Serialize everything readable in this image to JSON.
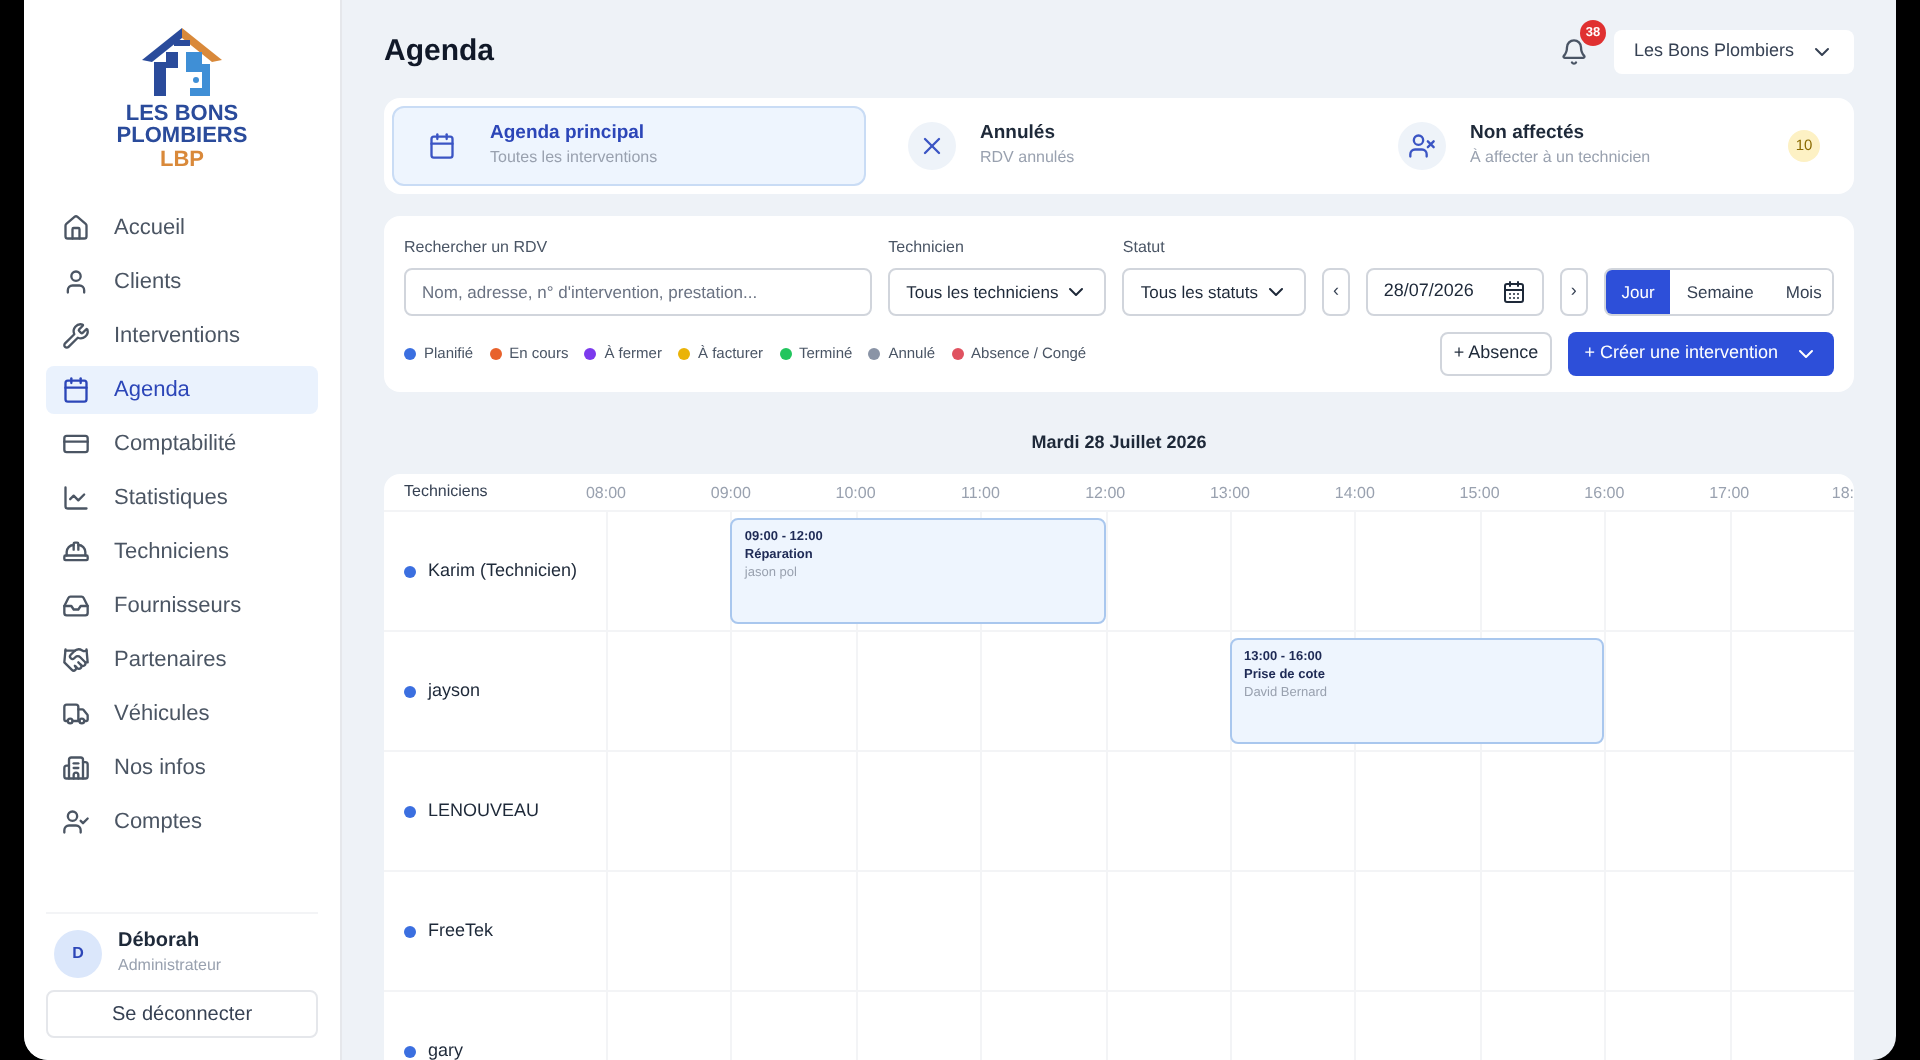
{
  "brand": {
    "line_1": "LES BONS",
    "line_2": "PLOMBIERS",
    "line_3": "LBP"
  },
  "sidebar": {
    "items": [
      {
        "label": "Accueil",
        "selected": false
      },
      {
        "label": "Clients",
        "selected": false
      },
      {
        "label": "Interventions",
        "selected": false
      },
      {
        "label": "Agenda",
        "selected": true
      },
      {
        "label": "Comptabilité",
        "selected": false
      },
      {
        "label": "Statistiques",
        "selected": false
      },
      {
        "label": "Techniciens",
        "selected": false
      },
      {
        "label": "Fournisseurs",
        "selected": false
      },
      {
        "label": "Partenaires",
        "selected": false
      },
      {
        "label": "Véhicules",
        "selected": false
      },
      {
        "label": "Nos infos",
        "selected": false
      },
      {
        "label": "Comptes",
        "selected": false
      }
    ],
    "user": {
      "initial": "D",
      "name": "Déborah",
      "role": "Administrateur"
    },
    "logout": "Se déconnecter"
  },
  "header": {
    "title": "Agenda",
    "notifications": "38",
    "company": "Les Bons Plombiers"
  },
  "tabs": [
    {
      "title": "Agenda principal",
      "subtitle": "Toutes les interventions",
      "selected": true
    },
    {
      "title": "Annulés",
      "subtitle": "RDV annulés",
      "selected": false
    },
    {
      "title": "Non affectés",
      "subtitle": "À affecter à un technicien",
      "selected": false,
      "count": "10"
    }
  ],
  "filters": {
    "search": {
      "label": "Rechercher un RDV",
      "placeholder": "Nom, adresse, n° d'intervention, prestation..."
    },
    "technician": {
      "label": "Technicien",
      "value": "Tous les techniciens"
    },
    "status": {
      "label": "Statut",
      "value": "Tous les statuts"
    },
    "date": "28/07/2026",
    "prev": "‹",
    "next": "›",
    "views": [
      {
        "label": "Jour",
        "selected": true
      },
      {
        "label": "Semaine",
        "selected": false
      },
      {
        "label": "Mois",
        "selected": false
      }
    ],
    "legend": [
      {
        "label": "Planifié",
        "color": "#3b6fe0"
      },
      {
        "label": "En cours",
        "color": "#e8622c"
      },
      {
        "label": "À fermer",
        "color": "#7c3aed"
      },
      {
        "label": "À facturer",
        "color": "#eab308"
      },
      {
        "label": "Terminé",
        "color": "#22c55e"
      },
      {
        "label": "Annulé",
        "color": "#8a94a6"
      },
      {
        "label": "Absence / Congé",
        "color": "#e05260"
      }
    ],
    "absence_button": "+ Absence",
    "create_button": "+ Créer une intervention"
  },
  "schedule": {
    "date": "Mardi 28 Juillet 2026",
    "column_header": "Techniciens",
    "hours": [
      "08:00",
      "09:00",
      "10:00",
      "11:00",
      "12:00",
      "13:00",
      "14:00",
      "15:00",
      "16:00",
      "17:00",
      "18:"
    ],
    "rows": [
      {
        "name": "Karim (Technicien)",
        "color": "#3b6fe0",
        "events": [
          {
            "time": "09:00 - 12:00",
            "title": "Réparation",
            "client": "jason pol"
          }
        ]
      },
      {
        "name": "jayson",
        "color": "#3b6fe0",
        "events": [
          {
            "time": "13:00 - 16:00",
            "title": "Prise de cote",
            "client": "David Bernard"
          }
        ]
      },
      {
        "name": "LENOUVEAU",
        "color": "#3b6fe0",
        "events": []
      },
      {
        "name": "FreeTek",
        "color": "#3b6fe0",
        "events": []
      },
      {
        "name": "gary",
        "color": "#3b6fe0",
        "events": []
      }
    ]
  }
}
